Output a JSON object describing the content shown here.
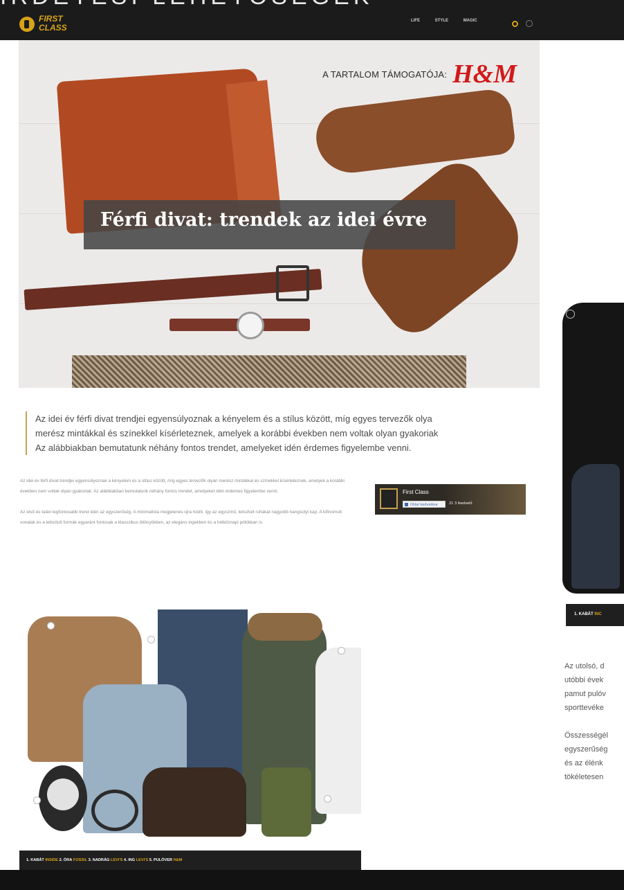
{
  "overlay_heading": "IRDETÉSI LEHETŐSÉGEK",
  "logo": {
    "line1": "FIRST",
    "line2": "CLASS"
  },
  "nav": {
    "items": [
      "LIFE",
      "STYLE",
      "MAGIC"
    ]
  },
  "hero": {
    "sponsor_text": "A TARTALOM TÁMOGATÓJA:",
    "sponsor_brand": "H&M",
    "title": "Férfi divat: trendek az idei évre"
  },
  "lead": [
    "Az idei év férfi divat trendjei egyensúlyoznak a kényelem és a stílus között, míg egyes tervezők olya",
    "merész mintákkal és színekkel kísérleteznek, amelyek a korábbi években nem voltak olyan gyakoriak",
    "Az alábbiakban bemutatunk néhány fontos trendet, amelyeket idén érdemes figyelembe venni."
  ],
  "body": {
    "p1": "Az idei év férfi divat trendjei egyensúlyoznak a kényelem és a stílus között, míg egyes tervezők olyan merész mintákkal és színekkel kísérleteznek, amelyek a korábbi években nem voltak olyan gyakoriak. Az alábbiakban bemutatunk néhány fontos trendet, amelyeket idén érdemes figyelembe venni.",
    "p2": "Az első és talán legfontosabb trend idén az egyszerűség. A minimalista megjelenés újra hódít, így az egyszínű, letisztult ruhákat nagyobb hangsúlyt kap. A kifinomult vonalak és a letisztult formák egyaránt fontosak a klasszikus öltönyökben, az elegáns ingekben és a hétköznapi pólókban is."
  },
  "fb_widget": {
    "name": "First Class",
    "like_label": "Oldal kedvelése",
    "count": "21 3 ikedvelő"
  },
  "coat_caption": {
    "prefix": "1. KABÁT",
    "brand": "INC"
  },
  "collage_caption": {
    "i1": "1. KABÁT",
    "b1": "INSIDE",
    "i2": "2. ÓRA",
    "b2": "FOSSIL",
    "i3": "3. NADRÁG",
    "b3": "LEVI'S",
    "i4": "4. ING",
    "b4": "LEVI'S",
    "i5": "5. PULÓVER",
    "b5": "H&M"
  },
  "right_text": {
    "p1": [
      "Az utolsó, d",
      "utóbbi évek",
      "pamut pulóv",
      "sporttevéke"
    ],
    "p2": [
      "Összességél",
      "egyszerűség",
      "és az élénk",
      "tökéletesen"
    ]
  },
  "colors": {
    "accent": "#d7a31a",
    "dark": "#1b1b1b",
    "brand_red": "#d11a1a"
  }
}
